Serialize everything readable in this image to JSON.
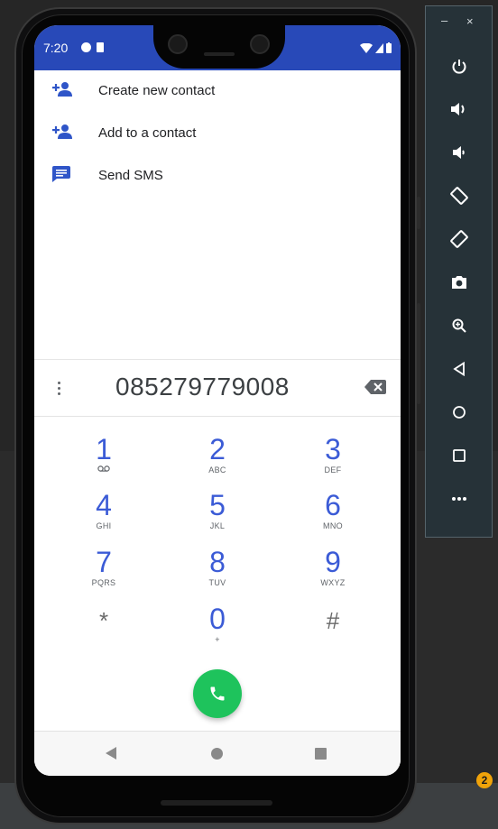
{
  "status_bar": {
    "time": "7:20"
  },
  "menu": [
    {
      "label": "Create new contact",
      "icon": "person-add-icon"
    },
    {
      "label": "Add to a contact",
      "icon": "person-add-icon"
    },
    {
      "label": "Send SMS",
      "icon": "message-icon"
    }
  ],
  "dialer": {
    "number": "085279779008",
    "keys": [
      {
        "digit": "1",
        "letters": ""
      },
      {
        "digit": "2",
        "letters": "ABC"
      },
      {
        "digit": "3",
        "letters": "DEF"
      },
      {
        "digit": "4",
        "letters": "GHI"
      },
      {
        "digit": "5",
        "letters": "JKL"
      },
      {
        "digit": "6",
        "letters": "MNO"
      },
      {
        "digit": "7",
        "letters": "PQRS"
      },
      {
        "digit": "8",
        "letters": "TUV"
      },
      {
        "digit": "9",
        "letters": "WXYZ"
      },
      {
        "digit": "*",
        "letters": ""
      },
      {
        "digit": "0",
        "letters": "+"
      },
      {
        "digit": "#",
        "letters": ""
      }
    ]
  },
  "colors": {
    "status_bar": "#2849b8",
    "accent": "#3b5bd6",
    "call_button": "#1ec35c",
    "toolbar": "#263238",
    "badge": "#f0a30a"
  },
  "notification_count": "2",
  "toolbar": {
    "minimize": "–",
    "close": "×",
    "buttons": [
      "power-icon",
      "volume-up-icon",
      "volume-down-icon",
      "rotate-left-icon",
      "rotate-right-icon",
      "camera-icon",
      "zoom-in-icon",
      "back-icon",
      "home-icon",
      "overview-icon",
      "more-icon"
    ]
  }
}
